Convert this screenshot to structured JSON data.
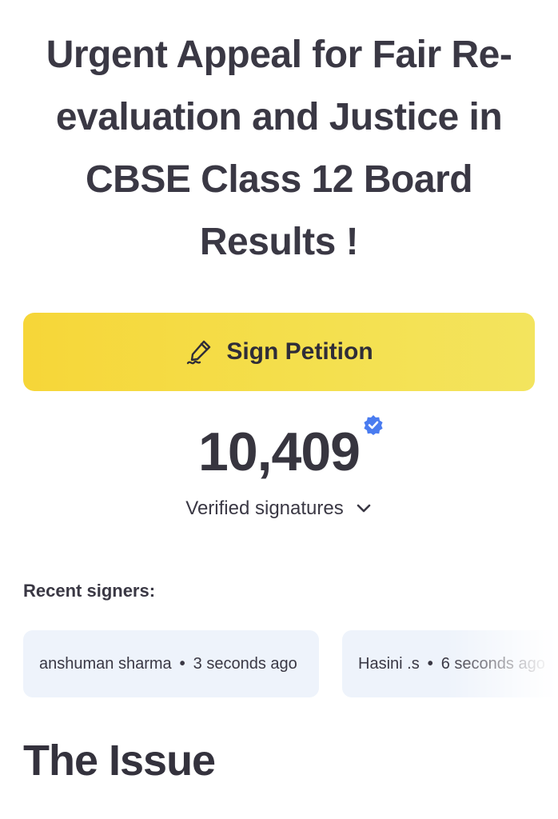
{
  "petition": {
    "title": "Urgent Appeal for Fair Re-evaluation and Justice in CBSE Class 12 Board Results !"
  },
  "sign_button": {
    "label": "Sign Petition",
    "icon": "pen-signature-icon",
    "color": "#f5dc45"
  },
  "signatures": {
    "count": "10,409",
    "verified_icon": "verified-check-badge-icon",
    "verified_color": "#4a7cf0",
    "label": "Verified signatures",
    "toggle_icon": "chevron-down-icon"
  },
  "recent": {
    "label": "Recent signers:",
    "signers": [
      {
        "name": "anshuman sharma",
        "separator": "•",
        "time": "3 seconds ago"
      },
      {
        "name": "Hasini .s",
        "separator": "•",
        "time": "6 seconds ago"
      }
    ]
  },
  "section": {
    "heading": "The Issue"
  }
}
